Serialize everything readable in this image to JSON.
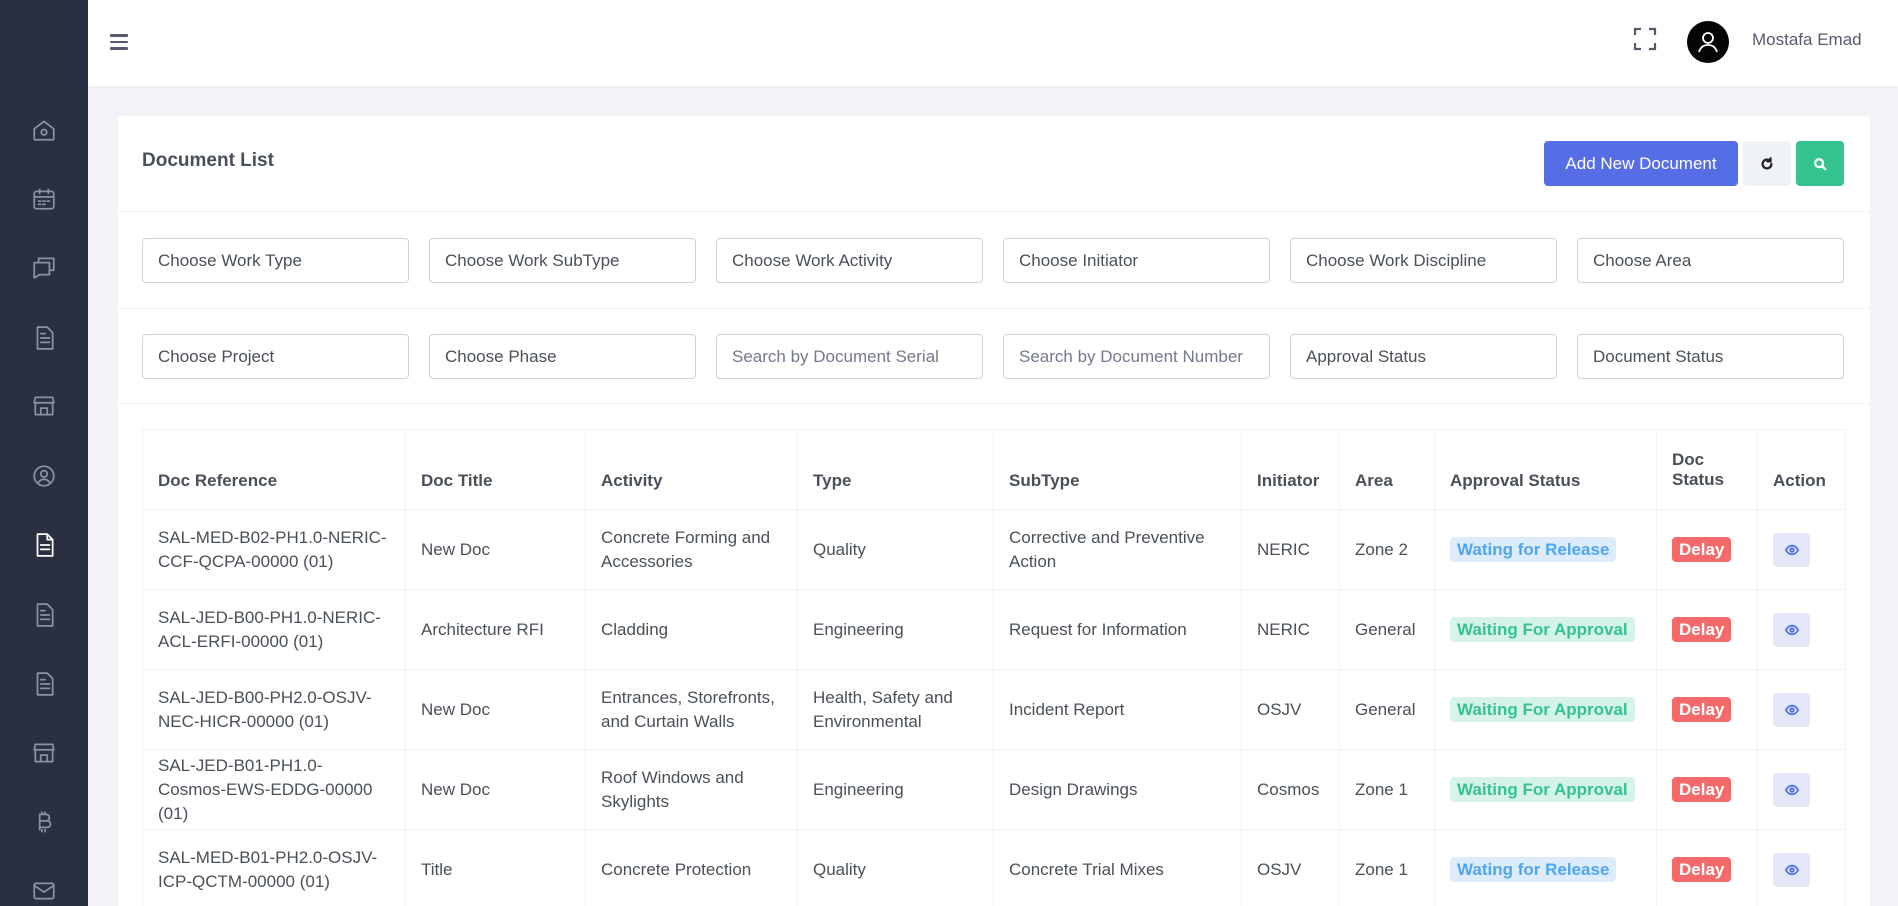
{
  "header": {
    "username": "Mostafa Emad"
  },
  "sidebar": {
    "icons": [
      "home-icon",
      "calendar-icon",
      "chat-icon",
      "file-icon",
      "store-icon",
      "user-circle-icon",
      "file-text-icon",
      "file-icon",
      "file-icon",
      "store-icon",
      "bitcoin-icon",
      "mail-icon"
    ],
    "active_index": 6
  },
  "card": {
    "title": "Document List",
    "add_button": "Add New Document"
  },
  "filters": {
    "row1": [
      "Choose Work Type",
      "Choose Work SubType",
      "Choose Work Activity",
      "Choose Initiator",
      "Choose Work Discipline",
      "Choose Area"
    ],
    "row2": {
      "project": "Choose Project",
      "phase": "Choose Phase",
      "serial_placeholder": "Search by Document Serial",
      "number_placeholder": "Search by Document Number",
      "approval": "Approval Status",
      "doc_status": "Document Status"
    }
  },
  "table": {
    "headers": [
      "Doc Reference",
      "Doc Title",
      "Activity",
      "Type",
      "SubType",
      "Initiator",
      "Area",
      "Approval Status",
      "Doc Status",
      "Action"
    ],
    "rows": [
      {
        "ref": "SAL-MED-B02-PH1.0-NERIC-CCF-QCPA-00000 (01)",
        "title": "New Doc",
        "activity": "Concrete Forming and Accessories",
        "type": "Quality",
        "subtype": "Corrective and Preventive Action",
        "initiator": "NERIC",
        "area": "Zone 2",
        "approval": "Wating for Release",
        "approval_kind": "info",
        "status": "Delay"
      },
      {
        "ref": "SAL-JED-B00-PH1.0-NERIC-ACL-ERFI-00000 (01)",
        "title": "Architecture RFI",
        "activity": "Cladding",
        "type": "Engineering",
        "subtype": "Request for Information",
        "initiator": "NERIC",
        "area": "General",
        "approval": "Waiting For Approval",
        "approval_kind": "success",
        "status": "Delay"
      },
      {
        "ref": "SAL-JED-B00-PH2.0-OSJV-NEC-HICR-00000 (01)",
        "title": "New Doc",
        "activity": "Entrances, Storefronts, and Curtain Walls",
        "type": "Health, Safety and Environmental",
        "subtype": "Incident Report",
        "initiator": "OSJV",
        "area": "General",
        "approval": "Waiting For Approval",
        "approval_kind": "success",
        "status": "Delay"
      },
      {
        "ref": "SAL-JED-B01-PH1.0-Cosmos-EWS-EDDG-00000 (01)",
        "title": "New Doc",
        "activity": "Roof Windows and Skylights",
        "type": "Engineering",
        "subtype": "Design Drawings",
        "initiator": "Cosmos",
        "area": "Zone 1",
        "approval": "Waiting For Approval",
        "approval_kind": "success",
        "status": "Delay"
      },
      {
        "ref": "SAL-MED-B01-PH2.0-OSJV-ICP-QCTM-00000 (01)",
        "title": "Title",
        "activity": "Concrete Protection",
        "type": "Quality",
        "subtype": "Concrete Trial Mixes",
        "initiator": "OSJV",
        "area": "Zone 1",
        "approval": "Wating for Release",
        "approval_kind": "info",
        "status": "Delay"
      }
    ]
  }
}
